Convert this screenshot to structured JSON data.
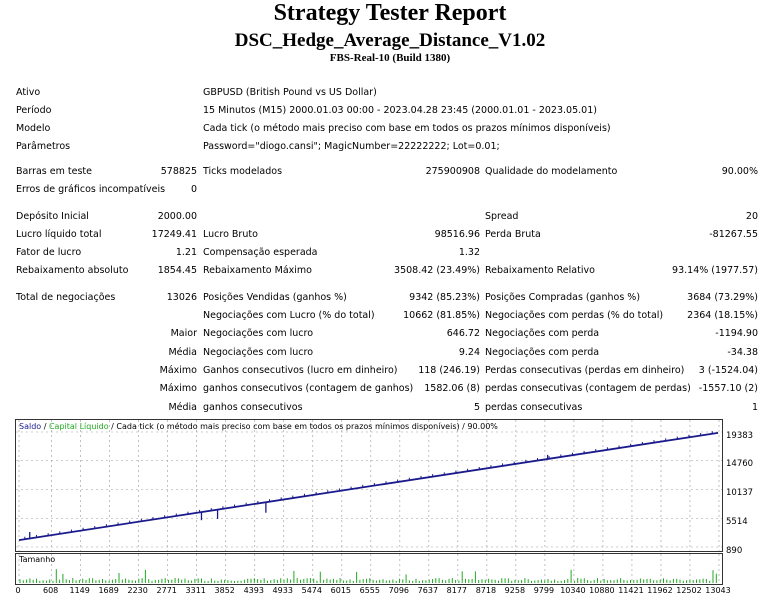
{
  "header": {
    "title": "Strategy Tester Report",
    "ea_name": "DSC_Hedge_Average_Distance_V1.02",
    "server": "FBS-Real-10 (Build 1380)"
  },
  "settings": {
    "ativo_label": "Ativo",
    "ativo_value": "GBPUSD (British Pound vs US Dollar)",
    "periodo_label": "Período",
    "periodo_value": "15 Minutos (M15) 2000.01.03 00:00 - 2023.04.28 23:45 (2000.01.01 - 2023.05.01)",
    "modelo_label": "Modelo",
    "modelo_value": "Cada tick (o método mais preciso com base em todos os prazos mínimos disponíveis)",
    "parametros_label": "Parâmetros",
    "parametros_value": "Password=\"diogo.cansi\"; MagicNumber=22222222; Lot=0.01;"
  },
  "results": {
    "barras_label": "Barras em teste",
    "barras_value": "578825",
    "ticks_label": "Ticks modelados",
    "ticks_value": "275900908",
    "qualidade_label": "Qualidade do modelamento",
    "qualidade_value": "90.00%",
    "erros_label": "Erros de gráficos incompatíveis",
    "erros_value": "0",
    "deposito_label": "Depósito Inicial",
    "deposito_value": "2000.00",
    "spread_label": "Spread",
    "spread_value": "20",
    "lucro_liq_label": "Lucro líquido total",
    "lucro_liq_value": "17249.41",
    "lucro_bruto_label": "Lucro Bruto",
    "lucro_bruto_value": "98516.96",
    "perda_bruta_label": "Perda Bruta",
    "perda_bruta_value": "-81267.55",
    "fator_label": "Fator de lucro",
    "fator_value": "1.21",
    "compensacao_label": "Compensação esperada",
    "compensacao_value": "1.32",
    "reb_abs_label": "Rebaixamento absoluto",
    "reb_abs_value": "1854.45",
    "reb_max_label": "Rebaixamento Máximo",
    "reb_max_value": "3508.42 (23.49%)",
    "reb_rel_label": "Rebaixamento Relativo",
    "reb_rel_value": "93.14% (1977.57)",
    "total_neg_label": "Total de negociações",
    "total_neg_value": "13026",
    "pos_vend_label": "Posições Vendidas (ganhos %)",
    "pos_vend_value": "9342 (85.23%)",
    "pos_comp_label": "Posições Compradas (ganhos %)",
    "pos_comp_value": "3684 (73.29%)",
    "neg_lucro_label": "Negociações com Lucro (% do total)",
    "neg_lucro_value": "10662 (81.85%)",
    "neg_perda_label": "Negociações com perdas (% do total)",
    "neg_perda_value": "2364 (18.15%)",
    "maior_label": "Maior",
    "maior_lucro_label": "Negociações com lucro",
    "maior_lucro_value": "646.72",
    "maior_perda_label": "Negociações com perda",
    "maior_perda_value": "-1194.90",
    "media_label": "Média",
    "media_lucro_label": "Negociações com lucro",
    "media_lucro_value": "9.24",
    "media_perda_label": "Negociações com perda",
    "media_perda_value": "-34.38",
    "maximo1_label": "Máximo",
    "max_ganhos_din_label": "Ganhos consecutivos (lucro em dinheiro)",
    "max_ganhos_din_value": "118 (246.19)",
    "max_perdas_din_label": "Perdas consecutivas (perdas em dinheiro)",
    "max_perdas_din_value": "3 (-1524.04)",
    "maximo2_label": "Máximo",
    "max_ganhos_cont_label": "ganhos consecutivos (contagem de ganhos)",
    "max_ganhos_cont_value": "1582.06 (8)",
    "max_perdas_cont_label": "perdas consecutivas (contagem de perdas)",
    "max_perdas_cont_value": "-1557.10 (2)",
    "media2_label": "Média",
    "media_ganhos_cons_label": "ganhos consecutivos",
    "media_ganhos_cons_value": "5",
    "media_perdas_cons_label": "perdas consecutivas",
    "media_perdas_cons_value": "1"
  },
  "chart_data": {
    "type": "line",
    "legend_saldo": "Saldo",
    "legend_sep": " / ",
    "legend_capital": "Capital Líquido",
    "legend_rest": " / Cada tick (o método mais preciso com base em todos os prazos mínimos disponíveis) / 90.00%",
    "volume_label": "Tamanho",
    "y_ticks": [
      "19383",
      "14760",
      "10137",
      "5514",
      "890"
    ],
    "x_ticks": [
      "0",
      "608",
      "1149",
      "1689",
      "2230",
      "2771",
      "3311",
      "3852",
      "4393",
      "4933",
      "5474",
      "6015",
      "6555",
      "7096",
      "7637",
      "8177",
      "8718",
      "9258",
      "9799",
      "10340",
      "10880",
      "11421",
      "11962",
      "12502",
      "13043"
    ],
    "ylim": [
      890,
      19383
    ],
    "xlim": [
      0,
      13043
    ],
    "balance": {
      "x": [
        0,
        13026
      ],
      "y": [
        2000,
        19249.41
      ]
    },
    "spikes": [
      {
        "x": 200,
        "y": 3300
      },
      {
        "x": 3400,
        "y": 5200
      },
      {
        "x": 3700,
        "y": 5400
      },
      {
        "x": 4600,
        "y": 6400
      },
      {
        "x": 9850,
        "y": 15700
      },
      {
        "x": 10400,
        "y": 15800
      }
    ],
    "colors": {
      "saldo": "#1a1a8c",
      "capital": "#22aa22",
      "volume": "#22aa22",
      "grid": "#999999"
    }
  }
}
